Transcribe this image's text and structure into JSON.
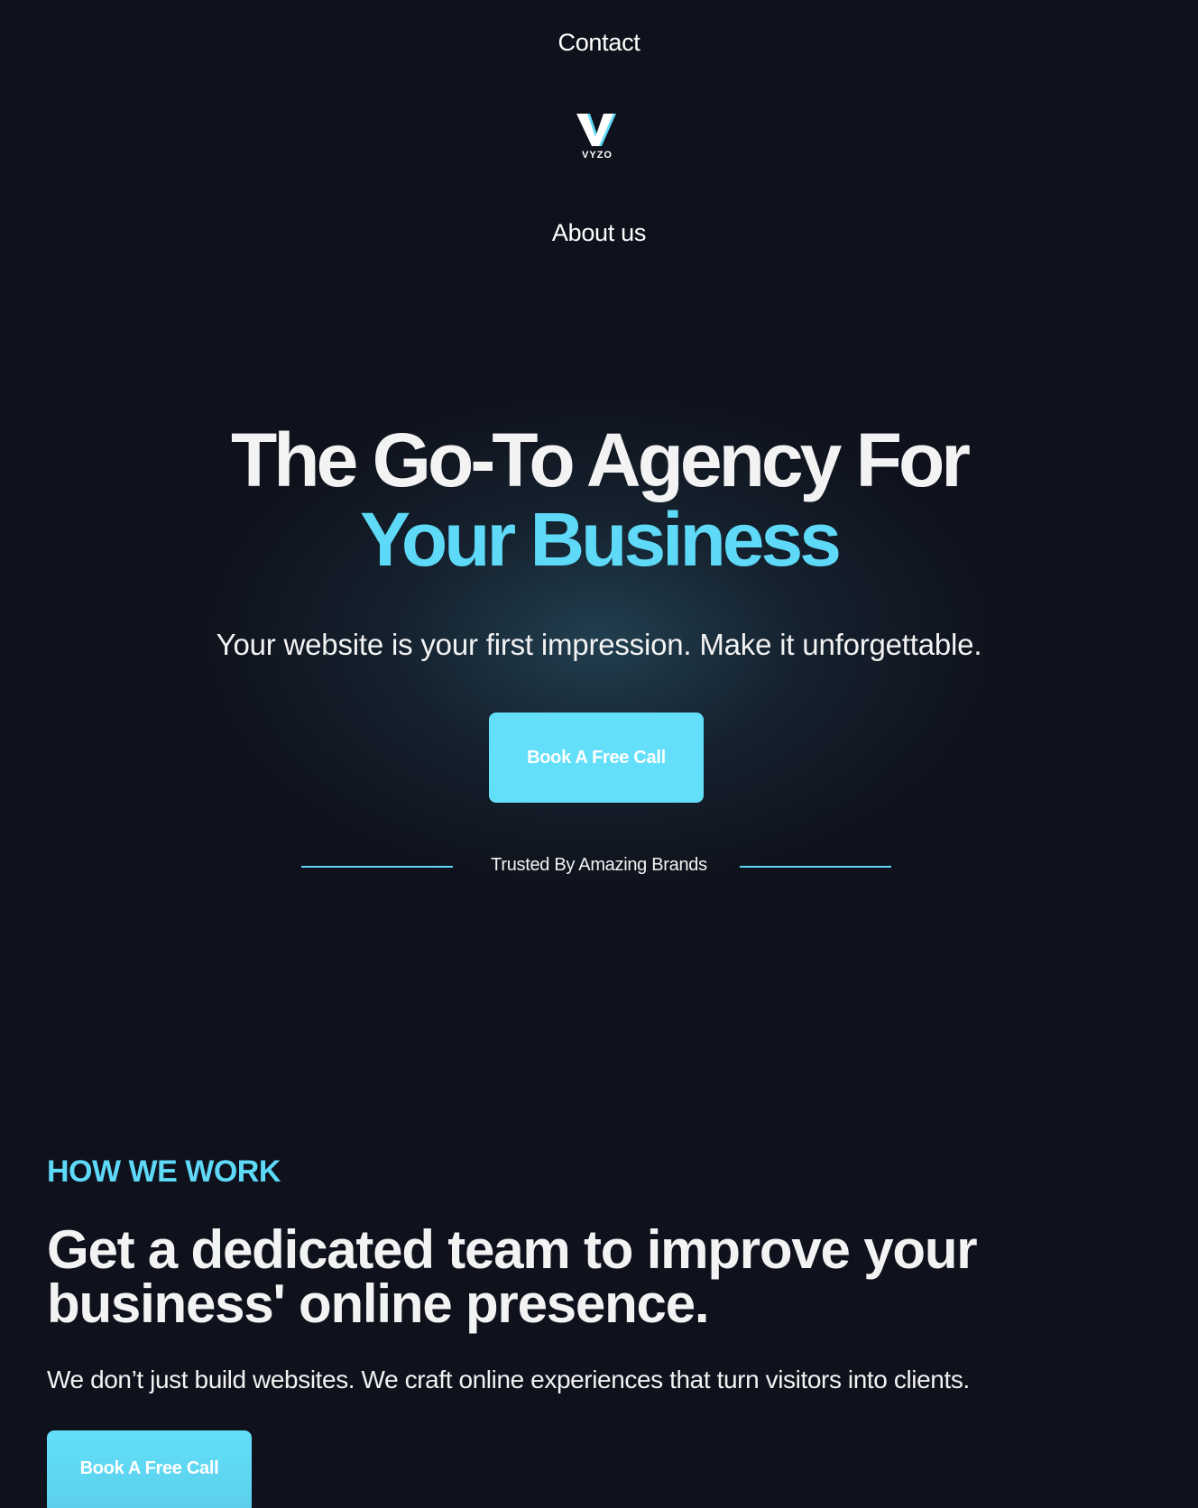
{
  "nav": {
    "contact_label": "Contact",
    "about_label": "About us"
  },
  "logo": {
    "wordmark": "VYZO",
    "icon": "vyzo-v-logo-icon"
  },
  "hero": {
    "title_line1": "The Go-To Agency For",
    "title_line2": "Your Business",
    "subtitle": "Your website is your first impression. Make it unforgettable.",
    "cta_label": "Book A Free Call",
    "trusted_label": "Trusted By Amazing Brands"
  },
  "how_we_work": {
    "eyebrow": "HOW WE WORK",
    "title": "Get a dedicated team to improve your business' online presence.",
    "subtitle": "We don’t just build websites. We craft online experiences that turn visitors into clients.",
    "cta_label": "Book A Free Call"
  },
  "colors": {
    "background": "#0f121c",
    "accent": "#5ed9f7",
    "button": "#63dffa",
    "text": "#ffffff"
  }
}
